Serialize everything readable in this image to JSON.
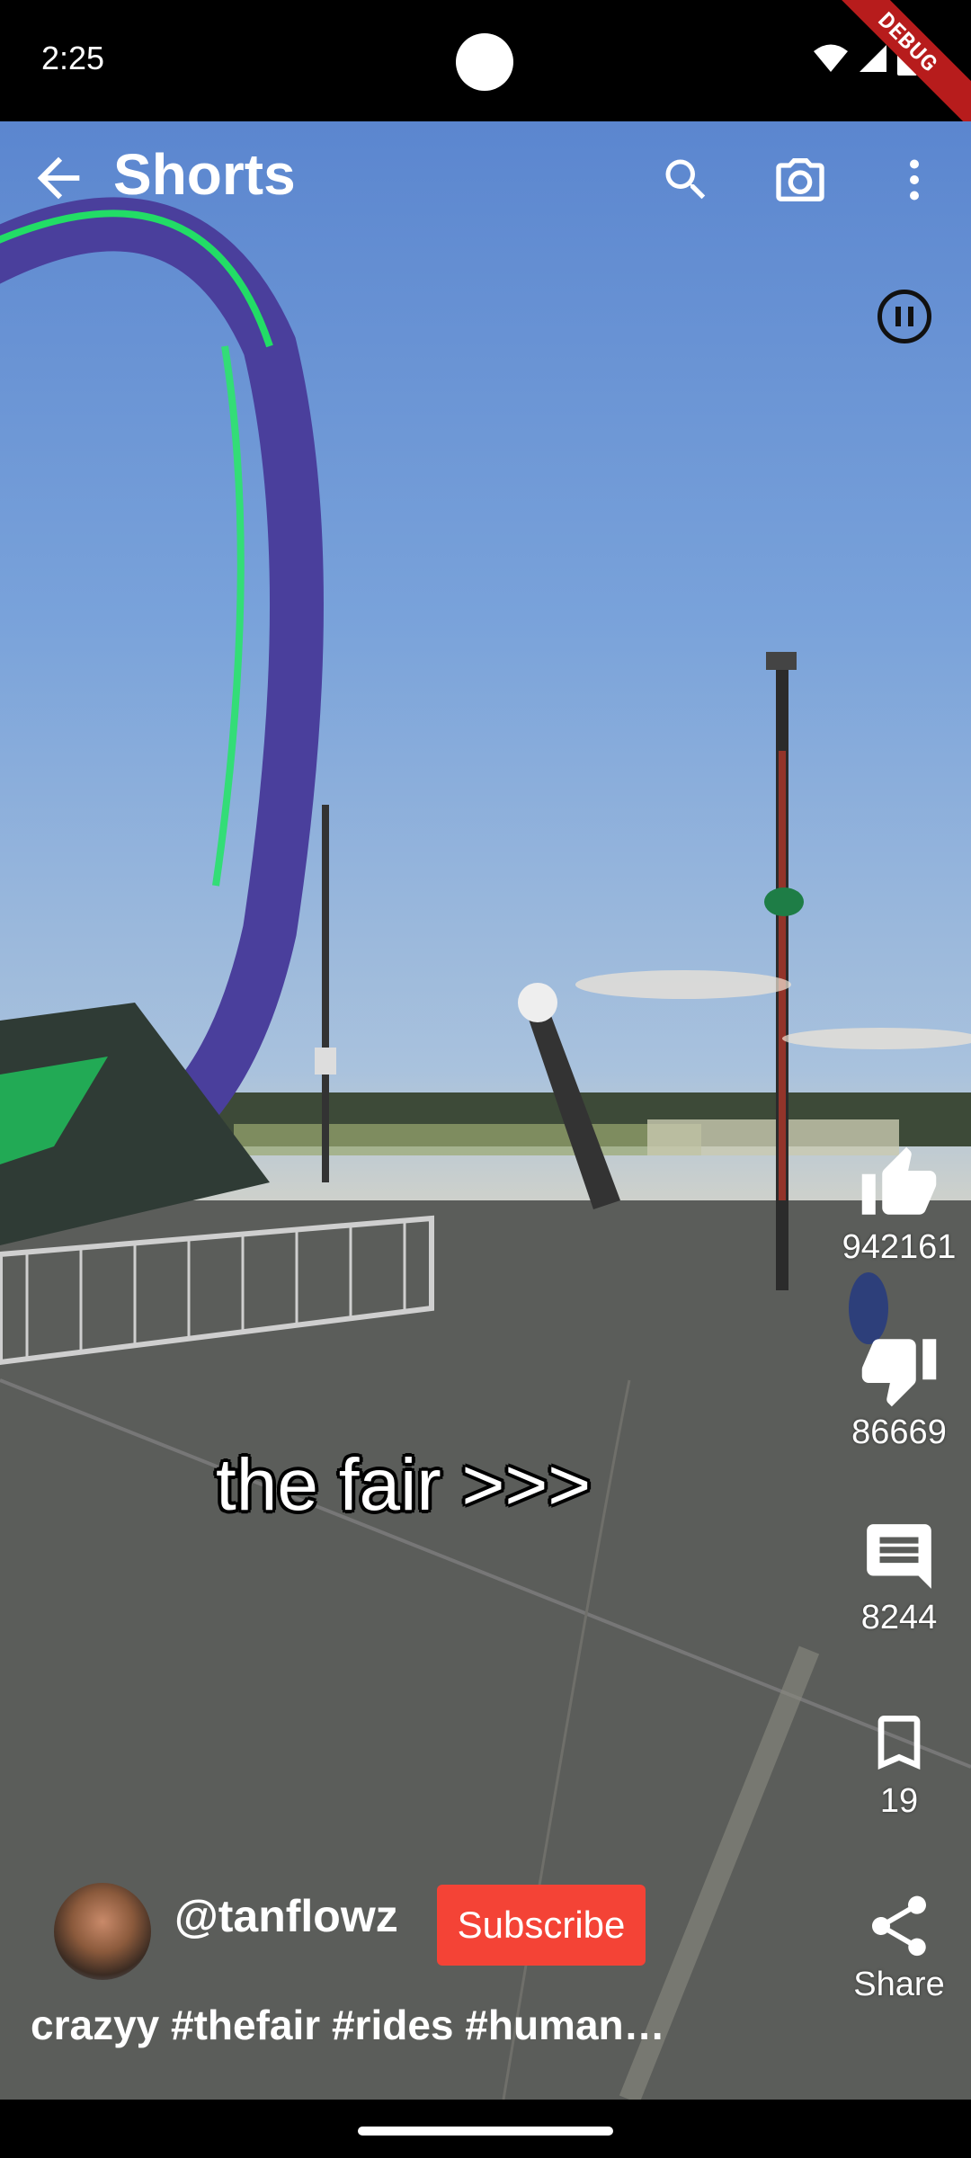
{
  "status_bar": {
    "time": "2:25",
    "debug_label": "DEBUG"
  },
  "app_bar": {
    "title": "Shorts"
  },
  "video": {
    "caption": "the fair >>>"
  },
  "actions": {
    "like_count": "942161",
    "dislike_count": "86669",
    "comment_count": "8244",
    "save_count": "19",
    "share_label": "Share"
  },
  "channel": {
    "handle": "@tanflowz",
    "subscribe_label": "Subscribe",
    "description": "crazyy #thefair #rides #humanslingshot"
  },
  "colors": {
    "subscribe": "#f44336",
    "debug": "#b71c1c"
  }
}
